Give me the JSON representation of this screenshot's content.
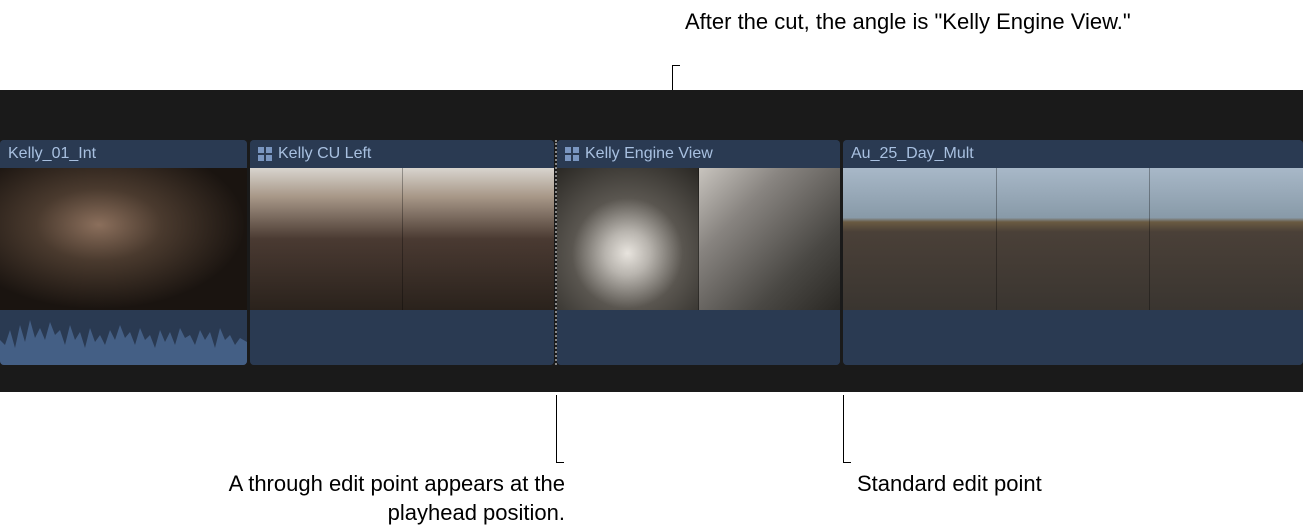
{
  "callouts": {
    "top": "After the cut, the angle is \"Kelly Engine View.\"",
    "bottomLeft": "A through edit point appears at the playhead position.",
    "bottomRight": "Standard edit point"
  },
  "clips": [
    {
      "name": "Kelly_01_Int",
      "multicam": false,
      "hasWaveform": true
    },
    {
      "name": "Kelly CU Left",
      "multicam": true,
      "hasWaveform": false
    },
    {
      "name": "Kelly Engine View",
      "multicam": true,
      "hasWaveform": false
    },
    {
      "name": "Au_25_Day_Mult",
      "multicam": false,
      "hasWaveform": false
    }
  ]
}
